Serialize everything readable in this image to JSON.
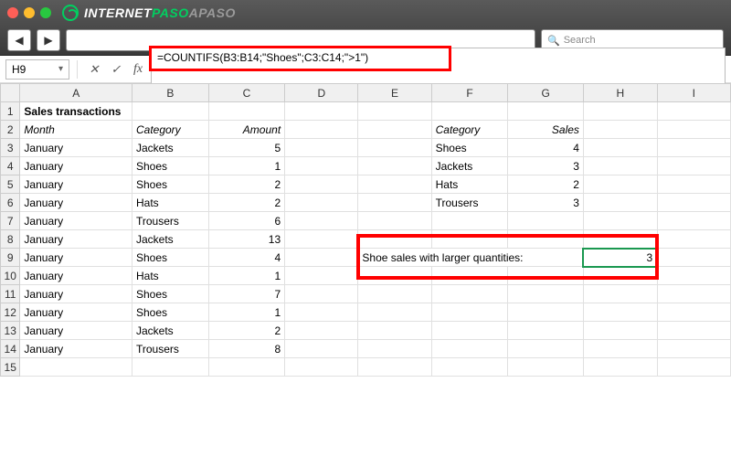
{
  "browser": {
    "brand1": "INTERNET",
    "brand2": "PASO",
    "brand3": "APASO",
    "search_placeholder": "Search"
  },
  "excel": {
    "name_box": "H9",
    "formula": "=COUNTIFS(B3:B14;\"Shoes\";C3:C14;\">1\")"
  },
  "columns": [
    "A",
    "B",
    "C",
    "D",
    "E",
    "F",
    "G",
    "H",
    "I"
  ],
  "rowCount": 15,
  "cells": {
    "A1": "Sales transactions",
    "A2": "Month",
    "B2": "Category",
    "C2": "Amount",
    "F2": "Category",
    "G2": "Sales",
    "A3": "January",
    "B3": "Jackets",
    "C3": "5",
    "F3": "Shoes",
    "G3": "4",
    "A4": "January",
    "B4": "Shoes",
    "C4": "1",
    "F4": "Jackets",
    "G4": "3",
    "A5": "January",
    "B5": "Shoes",
    "C5": "2",
    "F5": "Hats",
    "G5": "2",
    "A6": "January",
    "B6": "Hats",
    "C6": "2",
    "F6": "Trousers",
    "G6": "3",
    "A7": "January",
    "B7": "Trousers",
    "C7": "6",
    "A8": "January",
    "B8": "Jackets",
    "C8": "13",
    "A9": "January",
    "B9": "Shoes",
    "C9": "4",
    "E9": "Shoe sales with larger quantities:",
    "H9": "3",
    "A10": "January",
    "B10": "Hats",
    "C10": "1",
    "A11": "January",
    "B11": "Shoes",
    "C11": "7",
    "A12": "January",
    "B12": "Shoes",
    "C12": "1",
    "A13": "January",
    "B13": "Jackets",
    "C13": "2",
    "A14": "January",
    "B14": "Trousers",
    "C14": "8"
  },
  "numericCols": [
    "C",
    "G",
    "H"
  ],
  "boldCells": [
    "A1"
  ],
  "italicCells": [
    "A2",
    "B2",
    "C2",
    "F2",
    "G2"
  ],
  "activeCell": "H9"
}
